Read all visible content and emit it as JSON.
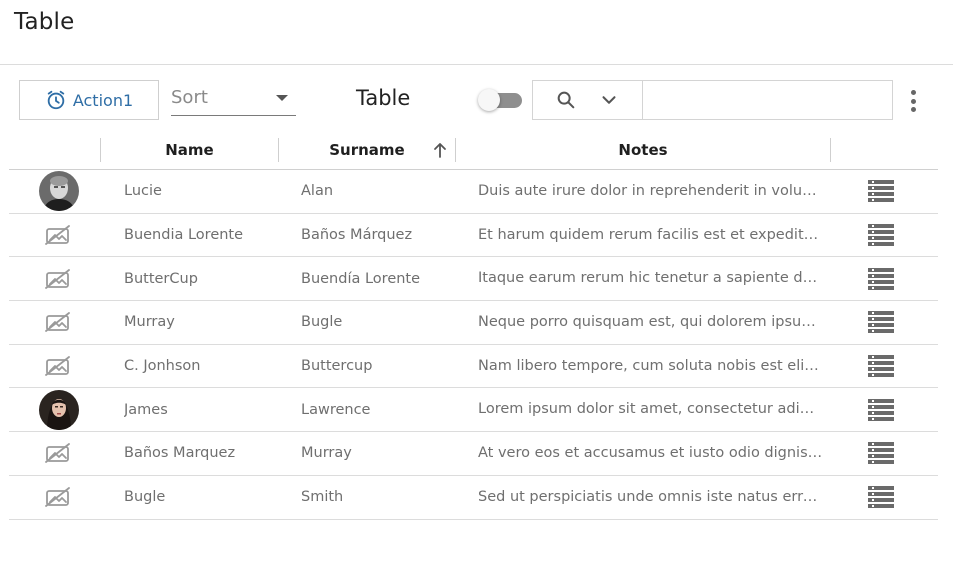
{
  "page": {
    "title": "Table"
  },
  "toolbar": {
    "action_label": "Action1",
    "sort_placeholder": "Sort",
    "table_label": "Table",
    "toggle_on": false,
    "search_value": ""
  },
  "columns": {
    "name": "Name",
    "surname": "Surname",
    "notes": "Notes",
    "sorted_column": "surname",
    "sort_direction": "ascending"
  },
  "rows": [
    {
      "avatar": "photo-man",
      "name": "Lucie",
      "surname": "Alan",
      "notes": "Duis aute irure dolor in reprehenderit in voluptate velit esse"
    },
    {
      "avatar": "no-image-icon",
      "name": "Buendia Lorente",
      "surname": "Baños Márquez",
      "notes": "Et harum quidem rerum facilis est et expedita distinctio"
    },
    {
      "avatar": "no-image-icon",
      "name": "ButterCup",
      "surname": "Buendía Lorente",
      "notes": "Itaque earum rerum hic tenetur a sapiente delectus"
    },
    {
      "avatar": "no-image-icon",
      "name": "Murray",
      "surname": "Bugle",
      "notes": "Neque porro quisquam est, qui dolorem ipsum quia dolor"
    },
    {
      "avatar": "no-image-icon",
      "name": "C. Jonhson",
      "surname": "Buttercup",
      "notes": "Nam libero tempore, cum soluta nobis est eligendi optio"
    },
    {
      "avatar": "photo-woman",
      "name": "James",
      "surname": "Lawrence",
      "notes": "Lorem ipsum dolor sit amet, consectetur adipiscing elit"
    },
    {
      "avatar": "no-image-icon",
      "name": "Baños Marquez",
      "surname": "Murray",
      "notes": "At vero eos et accusamus et iusto odio dignissimos"
    },
    {
      "avatar": "no-image-icon",
      "name": "Bugle",
      "surname": "Smith",
      "notes": "Sed ut perspiciatis unde omnis iste natus error sit"
    }
  ],
  "colors": {
    "accent": "#2f6ea6",
    "text": "#6f6f6f",
    "divider": "#dcdcdc"
  }
}
